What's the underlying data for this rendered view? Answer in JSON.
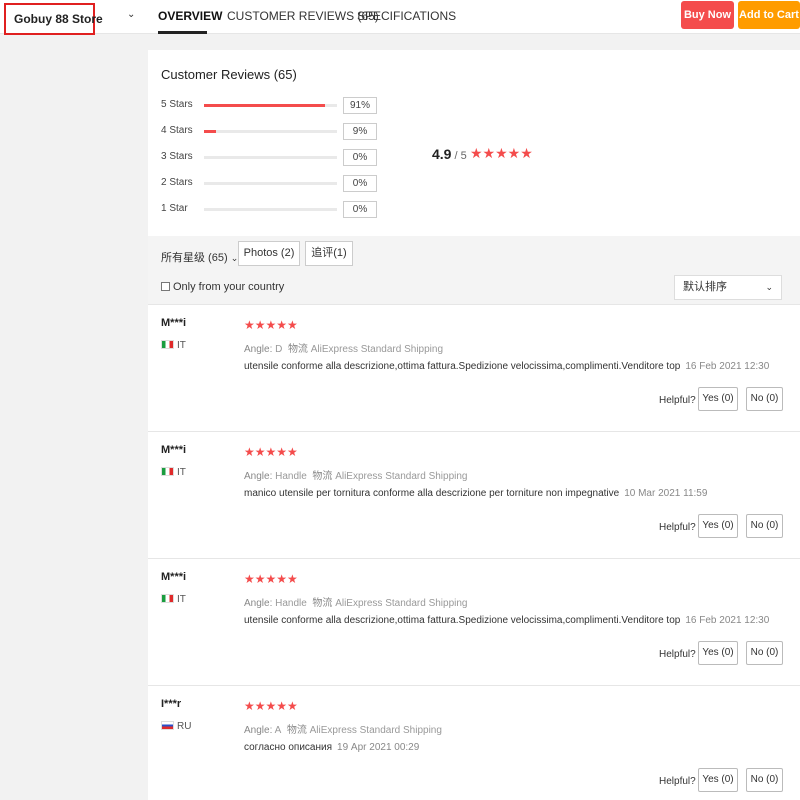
{
  "header": {
    "store_name": "Gobuy 88 Store",
    "tabs": [
      {
        "label": "OVERVIEW",
        "active": true
      },
      {
        "label": "CUSTOMER REVIEWS (65)",
        "active": false
      },
      {
        "label": "SPECIFICATIONS",
        "active": false
      }
    ],
    "buy_now": "Buy Now",
    "add_to_cart": "Add to Cart",
    "colors": {
      "buy_now": "#f44c4c",
      "add_to_cart": "#ff9c00"
    }
  },
  "reviews_summary": {
    "title": "Customer Reviews (65)",
    "distribution": [
      {
        "label": "5 Stars",
        "percent_text": "91%",
        "fill": 0.91
      },
      {
        "label": "4 Stars",
        "percent_text": "9%",
        "fill": 0.09
      },
      {
        "label": "3 Stars",
        "percent_text": "0%",
        "fill": 0
      },
      {
        "label": "2 Stars",
        "percent_text": "0%",
        "fill": 0
      },
      {
        "label": "1 Star",
        "percent_text": "0%",
        "fill": 0
      }
    ],
    "score": "4.9",
    "score_of": " / 5",
    "score_stars": "★★★★★"
  },
  "filters": {
    "all_label": "所有星级 (65)",
    "photos": "Photos (2)",
    "comments": "追评(1)",
    "only_country": "Only from your country",
    "sort_label": "默认排序"
  },
  "reviews": [
    {
      "name": "M***i",
      "country": "IT",
      "flag": "it",
      "stars": "★★★★★",
      "angle_key": "Angle:",
      "angle_val": "D",
      "shipping_key": "物流",
      "shipping_val": "AliExpress Standard Shipping",
      "text": "utensile conforme alla descrizione,ottima fattura.Spedizione velocissima,complimenti.Venditore top",
      "date": "16 Feb 2021 12:30",
      "helpful": "Helpful?",
      "yes": "Yes (0)",
      "no": "No (0)"
    },
    {
      "name": "M***i",
      "country": "IT",
      "flag": "it",
      "stars": "★★★★★",
      "angle_key": "Angle:",
      "angle_val": "Handle",
      "shipping_key": "物流",
      "shipping_val": "AliExpress Standard Shipping",
      "text": "manico utensile per tornitura conforme alla descrizione per torniture non impegnative",
      "date": "10 Mar 2021 11:59",
      "helpful": "Helpful?",
      "yes": "Yes (0)",
      "no": "No (0)"
    },
    {
      "name": "M***i",
      "country": "IT",
      "flag": "it",
      "stars": "★★★★★",
      "angle_key": "Angle:",
      "angle_val": "Handle",
      "shipping_key": "物流",
      "shipping_val": "AliExpress Standard Shipping",
      "text": "utensile conforme alla descrizione,ottima fattura.Spedizione velocissima,complimenti.Venditore top",
      "date": "16 Feb 2021 12:30",
      "helpful": "Helpful?",
      "yes": "Yes (0)",
      "no": "No (0)"
    },
    {
      "name": "I***r",
      "country": "RU",
      "flag": "ru",
      "stars": "★★★★★",
      "angle_key": "Angle:",
      "angle_val": "A",
      "shipping_key": "物流",
      "shipping_val": "AliExpress Standard Shipping",
      "text": "согласно описания",
      "date": "19 Apr 2021 00:29",
      "helpful": "Helpful?",
      "yes": "Yes (0)",
      "no": "No (0)"
    }
  ]
}
